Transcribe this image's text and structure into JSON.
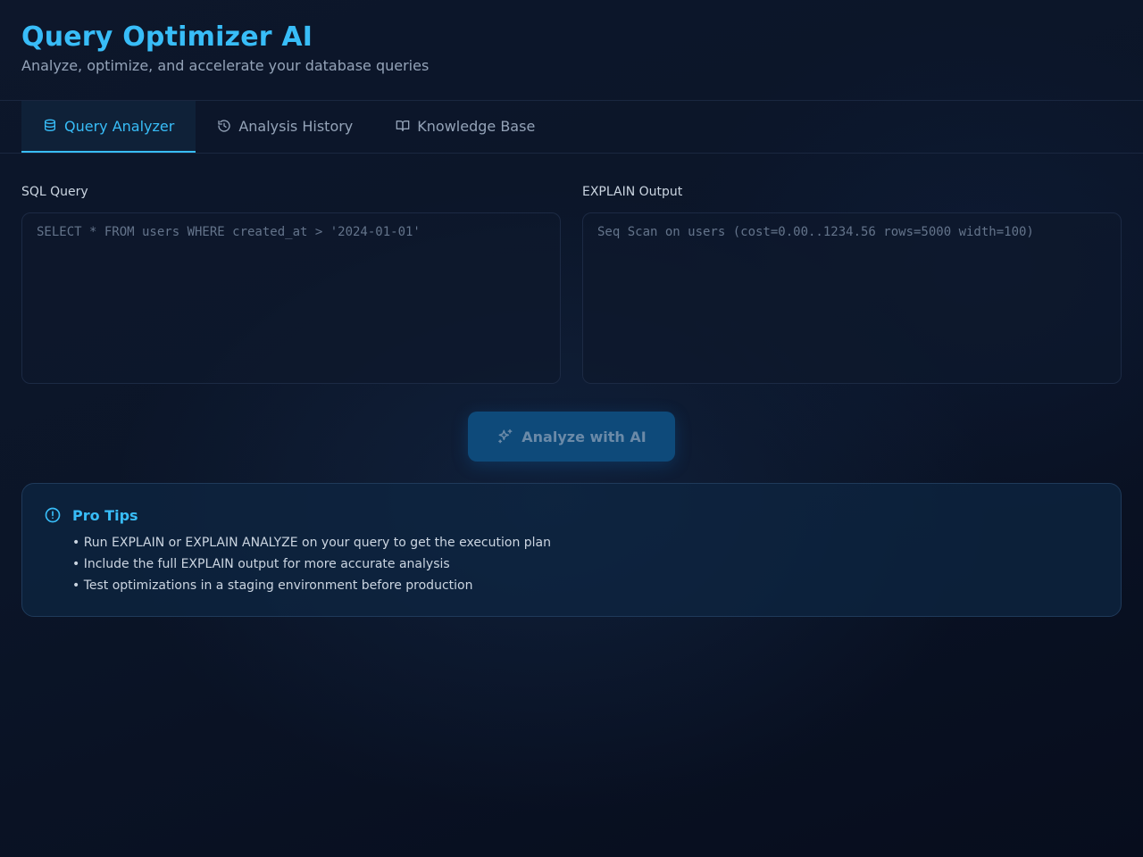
{
  "header": {
    "title": "Query Optimizer AI",
    "subtitle": "Analyze, optimize, and accelerate your database queries"
  },
  "tabs": [
    {
      "label": "Query Analyzer",
      "icon": "database-icon",
      "active": true
    },
    {
      "label": "Analysis History",
      "icon": "history-icon",
      "active": false
    },
    {
      "label": "Knowledge Base",
      "icon": "book-icon",
      "active": false
    }
  ],
  "editors": {
    "sql": {
      "label": "SQL Query",
      "value": "",
      "placeholder": "SELECT * FROM users WHERE created_at > '2024-01-01'"
    },
    "explain": {
      "label": "EXPLAIN Output",
      "value": "",
      "placeholder": "Seq Scan on users (cost=0.00..1234.56 rows=5000 width=100)"
    }
  },
  "analyze_button": {
    "label": "Analyze with AI",
    "icon": "sparkles-icon"
  },
  "tips": {
    "title": "Pro Tips",
    "icon": "alert-circle-icon",
    "items": [
      "• Run EXPLAIN or EXPLAIN ANALYZE on your query to get the execution plan",
      "• Include the full EXPLAIN output for more accurate analysis",
      "• Test optimizations in a staging environment before production"
    ]
  },
  "colors": {
    "accent": "#38bdf8",
    "background": "#0b1426",
    "button": "#0e4a7a"
  }
}
